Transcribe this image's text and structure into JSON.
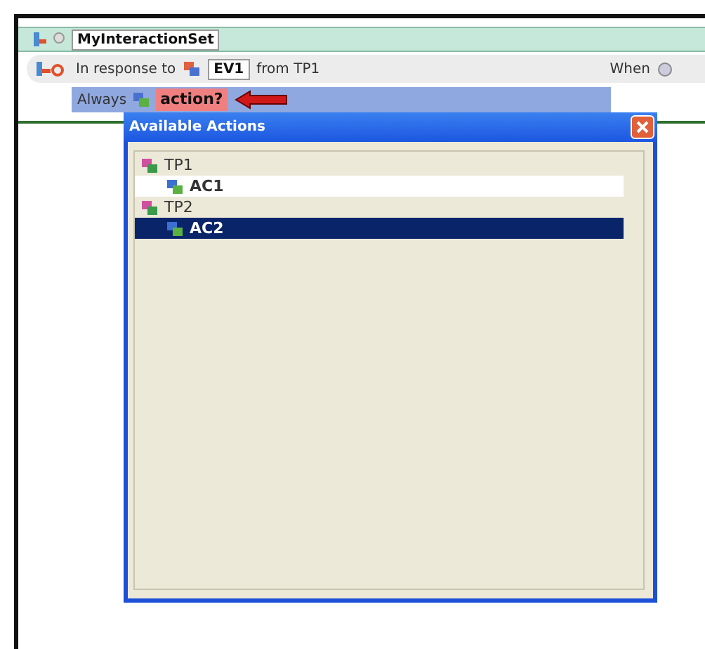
{
  "interaction_set": {
    "name": "MyInteractionSet"
  },
  "rule": {
    "prefix": "In response to",
    "event": "EV1",
    "suffix": "from TP1",
    "when": "When"
  },
  "action_row": {
    "prefix": "Always",
    "action": "action?"
  },
  "popup": {
    "title": "Available Actions",
    "tree": [
      {
        "label": "TP1",
        "selected": false,
        "children": [
          {
            "label": "AC1",
            "selected": false
          }
        ]
      },
      {
        "label": "TP2",
        "selected": false,
        "children": [
          {
            "label": "AC2",
            "selected": true
          }
        ]
      }
    ]
  }
}
